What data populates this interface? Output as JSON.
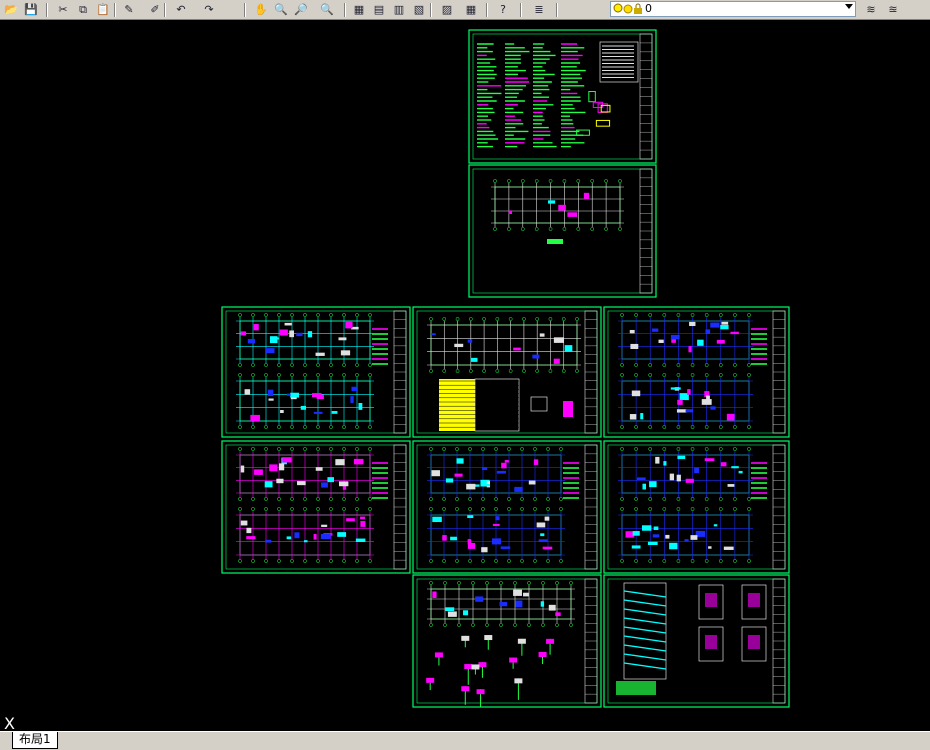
{
  "toolbar": {
    "buttons": [
      {
        "name": "open-icon",
        "glyph": "📂"
      },
      {
        "name": "save-icon",
        "glyph": "💾"
      },
      {
        "name": "cut-icon",
        "glyph": "✂"
      },
      {
        "name": "copy-icon",
        "glyph": "⧉"
      },
      {
        "name": "paste-icon",
        "glyph": "📋"
      },
      {
        "name": "match-properties-icon",
        "glyph": "✎"
      },
      {
        "name": "block-editor-icon",
        "glyph": "✐"
      },
      {
        "name": "undo-icon",
        "glyph": "↶"
      },
      {
        "name": "redo-icon",
        "glyph": "↷"
      },
      {
        "name": "pan-icon",
        "glyph": "✋"
      },
      {
        "name": "zoom-realtime-icon",
        "glyph": "🔍"
      },
      {
        "name": "zoom-window-icon",
        "glyph": "🔎"
      },
      {
        "name": "zoom-previous-icon",
        "glyph": "🔍"
      },
      {
        "name": "properties-icon",
        "glyph": "▦"
      },
      {
        "name": "design-center-icon",
        "glyph": "▤"
      },
      {
        "name": "tool-palettes-icon",
        "glyph": "▥"
      },
      {
        "name": "sheet-set-icon",
        "glyph": "▧"
      },
      {
        "name": "markup-icon",
        "glyph": "▨"
      },
      {
        "name": "calculator-icon",
        "glyph": "▦"
      },
      {
        "name": "help-icon",
        "glyph": "?"
      }
    ],
    "layer_manager_icon": "layers-icon",
    "current_layer": "0",
    "layer_state_icons": [
      "bulb-on-icon",
      "sun-icon",
      "lock-icon",
      "color-square-icon"
    ]
  },
  "layout_tab": {
    "label": "布局1"
  },
  "ucs_label": "X",
  "colors": {
    "background": "#000000",
    "frame": "#00ff66",
    "sheet": "#0a2a0a",
    "plan_blue": "#1a2cff",
    "text_green": "#22ff44",
    "text_white": "#e0e0e0",
    "accent_magenta": "#ff00ff",
    "accent_yellow": "#ffff00",
    "accent_cyan": "#00ffff"
  },
  "sheets": [
    {
      "id": "sheet-general-notes",
      "kind": "notes"
    },
    {
      "id": "sheet-foundation-plan",
      "kind": "foundation"
    },
    {
      "id": "sheet-column-plan-1",
      "kind": "plan-cyan"
    },
    {
      "id": "sheet-pile-plan",
      "kind": "pile-table"
    },
    {
      "id": "sheet-floor-plan-1",
      "kind": "plan-blue"
    },
    {
      "id": "sheet-beam-plan-1",
      "kind": "plan-magenta"
    },
    {
      "id": "sheet-slab-plan-1",
      "kind": "plan-blue"
    },
    {
      "id": "sheet-slab-plan-2",
      "kind": "plan-blue"
    },
    {
      "id": "sheet-roof-plan",
      "kind": "details"
    },
    {
      "id": "sheet-stair-details",
      "kind": "stair"
    }
  ]
}
